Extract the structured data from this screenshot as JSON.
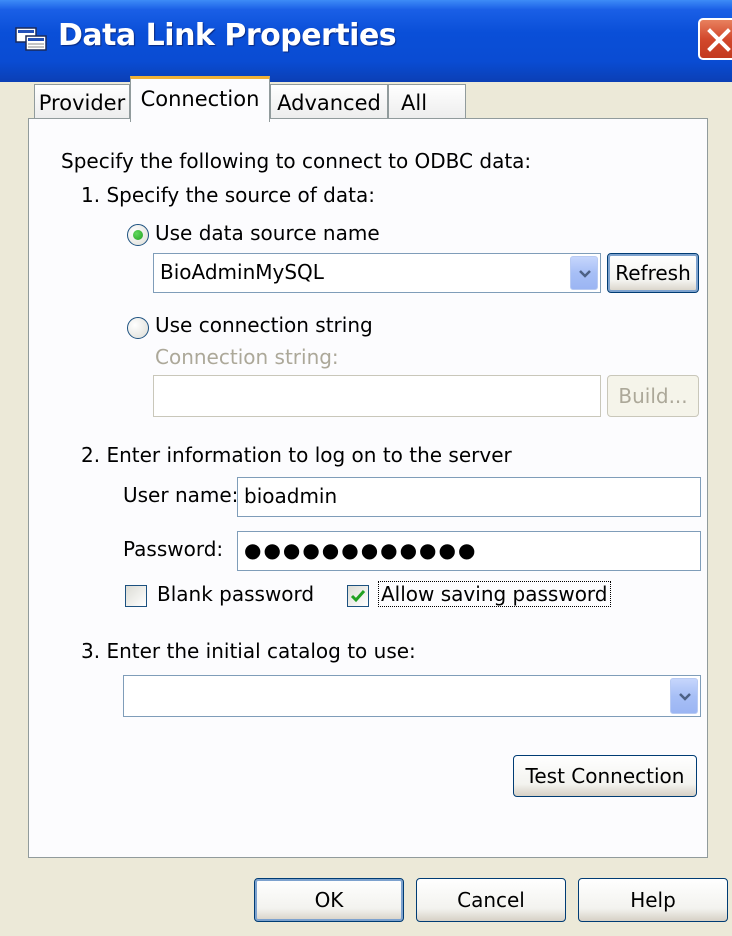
{
  "window": {
    "title": "Data Link Properties",
    "title_icon": "data-link-icon",
    "close_icon": "close-icon"
  },
  "tabs": [
    {
      "label": "Provider",
      "selected": false
    },
    {
      "label": "Connection",
      "selected": true
    },
    {
      "label": "Advanced",
      "selected": false
    },
    {
      "label": "All",
      "selected": false
    }
  ],
  "connection": {
    "intro": "Specify the following to connect to ODBC data:",
    "step1": "1. Specify the source of data:",
    "use_dsn_label": "Use data source name",
    "use_dsn_checked": true,
    "dsn_value": "BioAdminMySQL",
    "refresh_label": "Refresh",
    "use_connstr_label": "Use connection string",
    "use_connstr_checked": false,
    "connstr_label": "Connection string:",
    "connstr_value": "",
    "build_label": "Build...",
    "step2": "2. Enter information to log on to the server",
    "username_label": "User name:",
    "username_value": "bioadmin",
    "password_label": "Password:",
    "password_value": "●●●●●●●●●●●●",
    "blank_password_label": "Blank password",
    "blank_password_checked": false,
    "allow_saving_label": "Allow saving password",
    "allow_saving_checked": true,
    "step3": "3. Enter the initial catalog to use:",
    "catalog_value": "",
    "test_connection_label": "Test Connection"
  },
  "footer": {
    "ok_label": "OK",
    "cancel_label": "Cancel",
    "help_label": "Help"
  },
  "colors": {
    "titlebar": "#0a4cd3",
    "dialog_bg": "#ece9d8",
    "selected_tab_accent": "#f1b238",
    "close_button": "#d2482c"
  }
}
